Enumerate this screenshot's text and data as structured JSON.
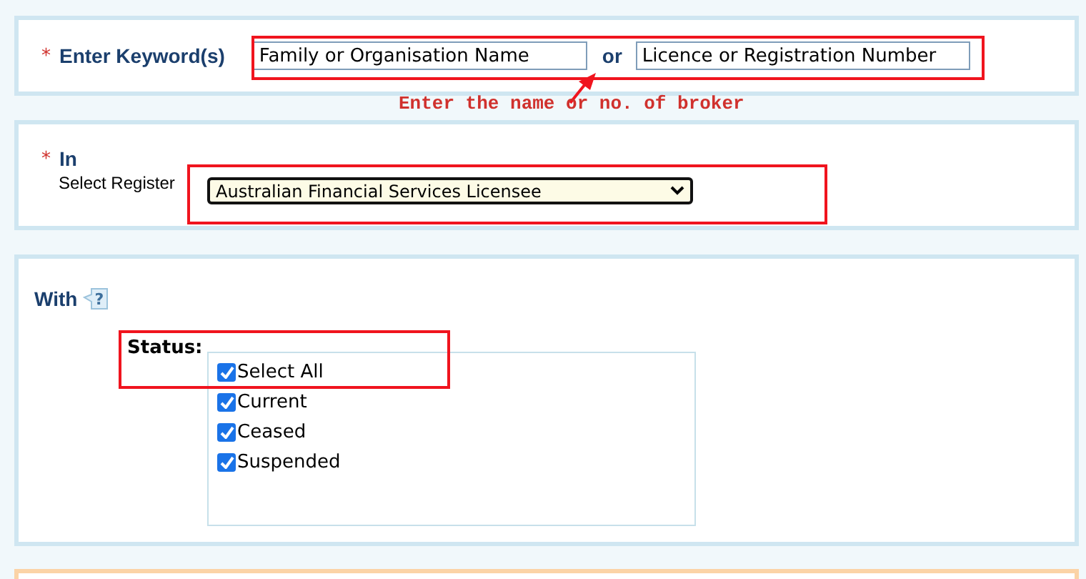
{
  "keyword_section": {
    "required_mark": "*",
    "label": "Enter Keyword(s)",
    "name_field": {
      "value": "Family or Organisation Name"
    },
    "separator": "or",
    "number_field": {
      "value": "Licence or Registration Number"
    },
    "annotation": "Enter the name or no. of broker"
  },
  "register_section": {
    "required_mark": "*",
    "label": "In",
    "select_label": "Select Register",
    "select_value": "Australian Financial Services Licensee"
  },
  "with_section": {
    "label": "With",
    "help_mark": "?",
    "status_label": "Status:",
    "statuses": [
      {
        "label": "Select All",
        "checked": true
      },
      {
        "label": "Current",
        "checked": true
      },
      {
        "label": "Ceased",
        "checked": true
      },
      {
        "label": "Suspended",
        "checked": true
      }
    ]
  }
}
